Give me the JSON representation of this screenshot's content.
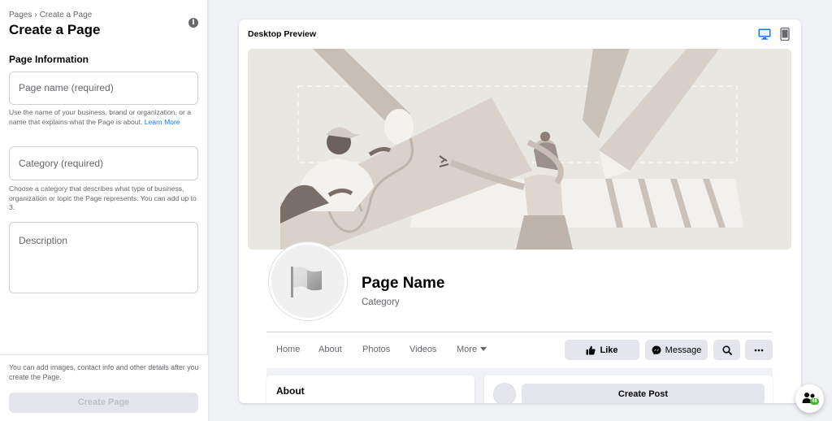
{
  "sidebar": {
    "breadcrumb": [
      "Pages",
      "Create a Page"
    ],
    "breadcrumb_sep": "›",
    "title": "Create a Page",
    "info_glyph": "i",
    "section_title": "Page Information",
    "name_field": {
      "placeholder": "Page name (required)",
      "value": ""
    },
    "name_helper": "Use the name of your business, brand or organization, or a name that explains what the Page is about.",
    "learn_more": "Learn More",
    "category_field": {
      "placeholder": "Category (required)",
      "value": ""
    },
    "category_helper": "Choose a category that describes what type of business, organization or topic the Page represents. You can add up to 3.",
    "description_field": {
      "placeholder": "Description",
      "value": ""
    },
    "footer_note": "You can add images, contact info and other details after you create the Page.",
    "create_button": "Create Page"
  },
  "preview": {
    "title": "Desktop Preview",
    "device_toggle": {
      "active": "desktop-icon",
      "inactive": "mobile-icon",
      "active_color": "#1877f2"
    },
    "page_name": "Page Name",
    "page_category": "Category",
    "tabs": [
      "Home",
      "About",
      "Photos",
      "Videos",
      "More"
    ],
    "actions": {
      "like": "Like",
      "message": "Message"
    },
    "about_title": "About",
    "post_button": "Create Post"
  },
  "chat": {
    "badge": "46"
  },
  "colors": {
    "accent": "#1877f2",
    "cover_bg": "#e9e7e2",
    "button_bg": "#e4e6eb"
  }
}
